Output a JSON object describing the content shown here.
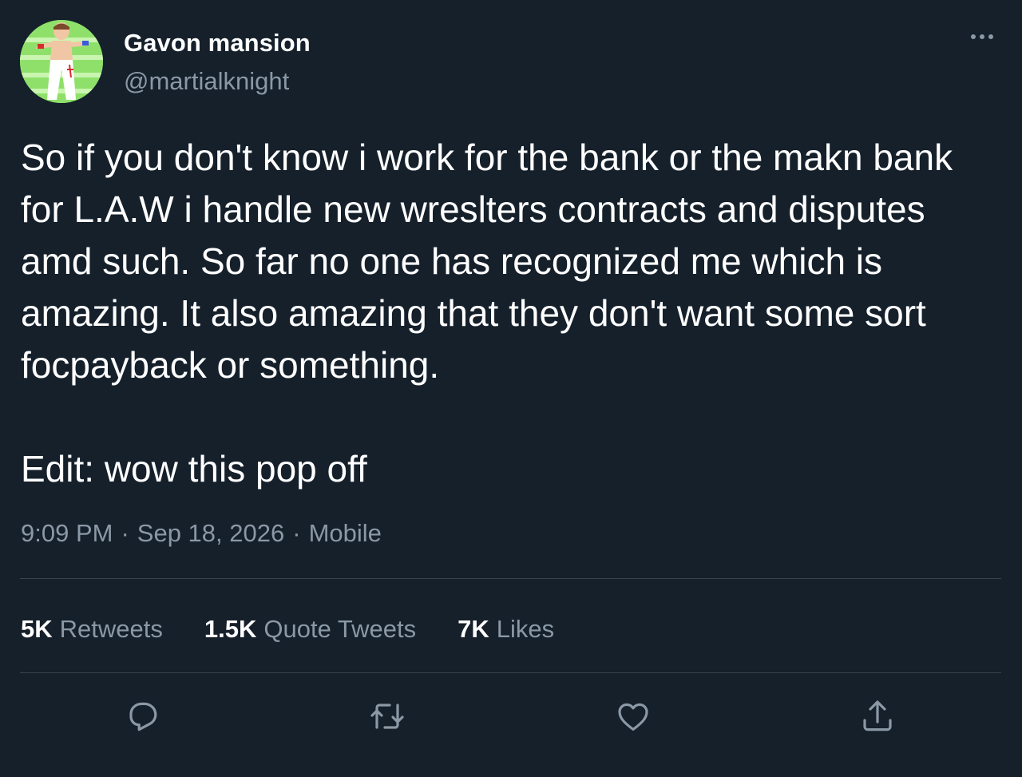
{
  "user": {
    "display_name": "Gavon mansion",
    "handle": "@martialknight",
    "avatar": "avatar-wrestler-image"
  },
  "menu": {
    "icon": "more-horizontal-icon"
  },
  "tweet": {
    "text": "So if you don't know i work for the bank or the makn bank for L.A.W i handle new wreslters contracts and disputes amd such. So far no one has recognized me which is amazing. It also amazing that they don't want some sort focpayback or something.\n\nEdit: wow this pop off",
    "time": "9:09 PM",
    "date": "Sep 18, 2026",
    "source": "Mobile",
    "separator": "·"
  },
  "stats": {
    "retweets_count": "5K",
    "retweets_label": "Retweets",
    "quotes_count": "1.5K",
    "quotes_label": "Quote Tweets",
    "likes_count": "7K",
    "likes_label": "Likes"
  },
  "actions": {
    "reply_icon": "reply-icon",
    "retweet_icon": "retweet-icon",
    "like_icon": "heart-icon",
    "share_icon": "share-icon"
  },
  "colors": {
    "background": "#15202b",
    "text_primary": "#ffffff",
    "text_secondary": "#8b98a5",
    "divider": "#38444d"
  }
}
